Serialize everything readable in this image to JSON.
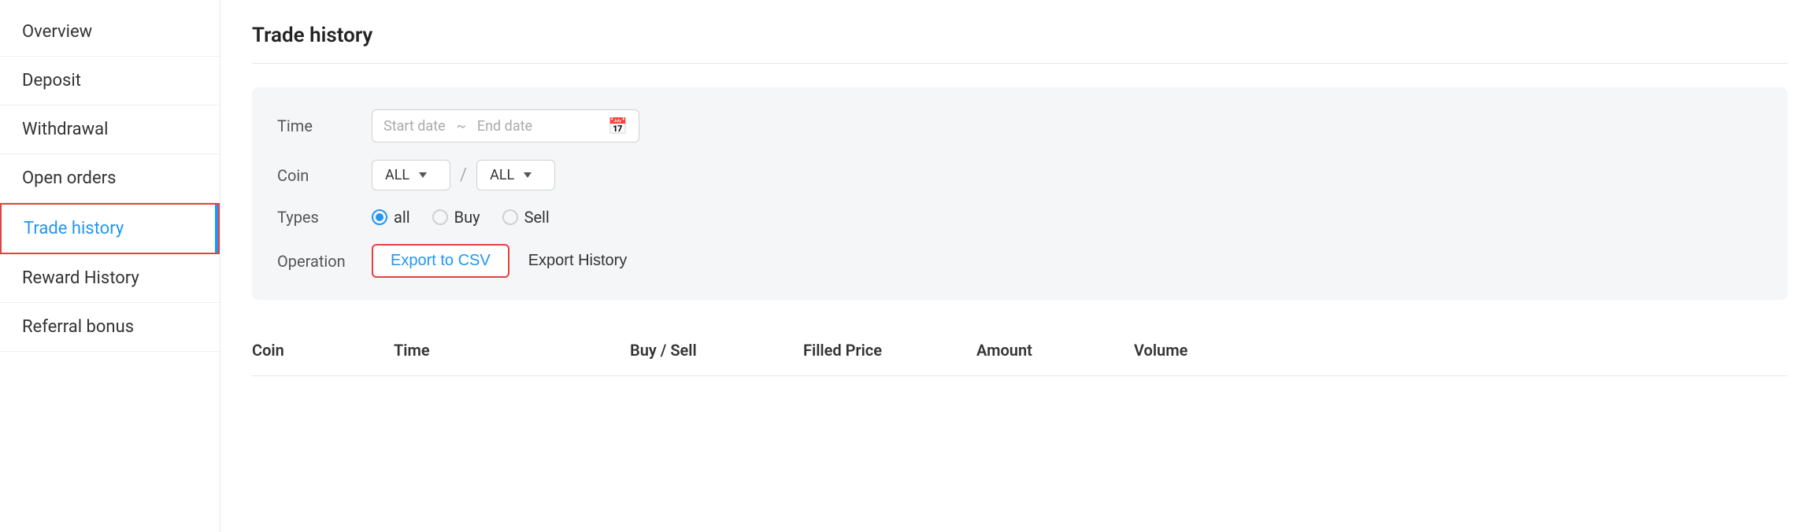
{
  "sidebar": {
    "items": [
      {
        "label": "Overview",
        "active": false
      },
      {
        "label": "Deposit",
        "active": false
      },
      {
        "label": "Withdrawal",
        "active": false
      },
      {
        "label": "Open orders",
        "active": false
      },
      {
        "label": "Trade history",
        "active": true
      },
      {
        "label": "Reward History",
        "active": false
      },
      {
        "label": "Referral bonus",
        "active": false
      }
    ]
  },
  "main": {
    "page_title": "Trade history",
    "filters": {
      "time_label": "Time",
      "start_date_placeholder": "Start date",
      "tilde": "~",
      "end_date_placeholder": "End date",
      "coin_label": "Coin",
      "coin_left": "ALL",
      "coin_right": "ALL",
      "slash": "/",
      "types_label": "Types",
      "type_all": "all",
      "type_buy": "Buy",
      "type_sell": "Sell",
      "operation_label": "Operation",
      "export_csv_label": "Export to CSV",
      "export_history_label": "Export History"
    },
    "table_headers": [
      "Coin",
      "Time",
      "Buy / Sell",
      "Filled Price",
      "Amount",
      "Volume"
    ]
  }
}
